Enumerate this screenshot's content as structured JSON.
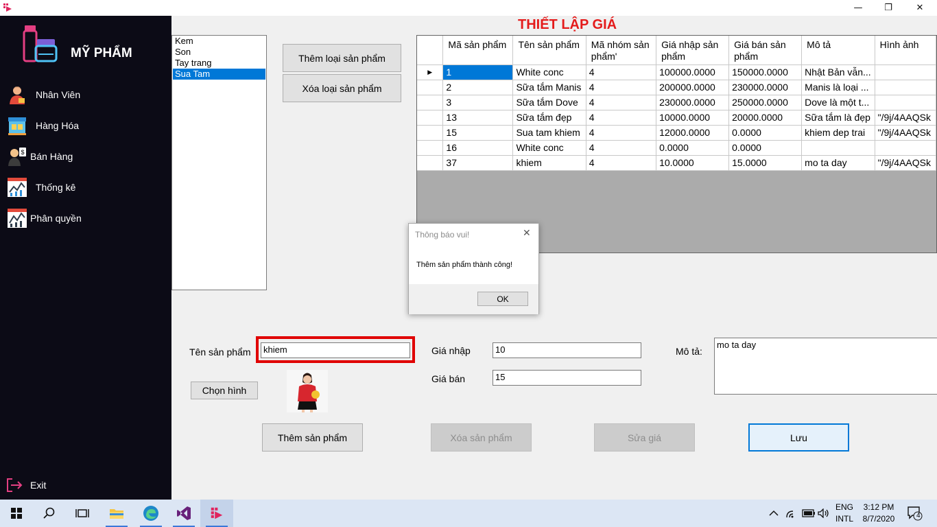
{
  "window": {
    "minimize_glyph": "—",
    "maximize_glyph": "❐",
    "close_glyph": "✕"
  },
  "sidebar": {
    "brand": "MỸ PHẨM",
    "items": [
      {
        "label": "Nhân Viên",
        "icon": "employee-icon"
      },
      {
        "label": "Hàng Hóa",
        "icon": "store-icon"
      },
      {
        "label": "Bán Hàng",
        "icon": "sales-person-icon"
      },
      {
        "label": "Thống kê",
        "icon": "statistics-icon"
      },
      {
        "label": "Phân quyền",
        "icon": "permission-chart-icon"
      }
    ],
    "exit_label": "Exit"
  },
  "category_list": {
    "items": [
      "Kem",
      "Son",
      "Tay trang",
      "Sua Tam"
    ],
    "selected": "Sua Tam"
  },
  "buttons": {
    "add_category": "Thêm loại sản phẩm",
    "delete_category": "Xóa loại sản phẩm",
    "choose_image": "Chọn hình",
    "add_product": "Thêm sản phẩm",
    "delete_product": "Xóa sản phẩm",
    "edit_price": "Sửa giá",
    "save": "Lưu"
  },
  "page_title": "THIẾT LẬP GIÁ",
  "grid": {
    "columns": [
      "Mã sản phẩm",
      "Tên sản phẩm",
      "Mã nhóm sản phẩm'",
      "Giá nhập sản phẩm",
      "Giá bán sản phẩm",
      "Mô tả",
      "Hình ảnh"
    ],
    "rows": [
      [
        "1",
        "White conc",
        "4",
        "100000.0000",
        "150000.0000",
        "Nhật Bản vẫn...",
        ""
      ],
      [
        "2",
        "Sữa tắm Manis",
        "4",
        "200000.0000",
        "230000.0000",
        " Manis là loại ...",
        ""
      ],
      [
        "3",
        "Sữa tắm Dove",
        "4",
        "230000.0000",
        "250000.0000",
        "Dove là một t...",
        ""
      ],
      [
        "13",
        "Sữa tắm đẹp",
        "4",
        "10000.0000",
        "20000.0000",
        "Sữa tắm là đẹp",
        "\"/9j/4AAQSk"
      ],
      [
        "15",
        "Sua tam khiem",
        "4",
        "12000.0000",
        "0.0000",
        "khiem dep trai",
        "\"/9j/4AAQSk"
      ],
      [
        "16",
        "White conc",
        "4",
        "0.0000",
        "0.0000",
        "",
        ""
      ],
      [
        "37",
        "khiem",
        "4",
        "10.0000",
        "15.0000",
        "mo ta day",
        "\"/9j/4AAQSk"
      ]
    ],
    "current_row_marker": "▶"
  },
  "dialog": {
    "title": "Thông báo vui!",
    "message": "Thêm sản phẩm thành công!",
    "ok": "OK"
  },
  "form": {
    "product_name_label": "Tên sản phẩm",
    "product_name_value": "khiem",
    "cost_label": "Giá nhập",
    "cost_value": "10",
    "price_label": "Giá bán",
    "price_value": "15",
    "desc_label": "Mô tả:",
    "desc_value": "mo ta day"
  },
  "taskbar": {
    "lang_top": "ENG",
    "lang_bottom": "INTL",
    "time": "3:12 PM",
    "date": "8/7/2020",
    "notification_count": "4"
  },
  "colors": {
    "sidebar_bg": "#0c0b16",
    "title_red": "#e41b1b",
    "selection_blue": "#0078d7",
    "highlight_red": "#e00000"
  }
}
